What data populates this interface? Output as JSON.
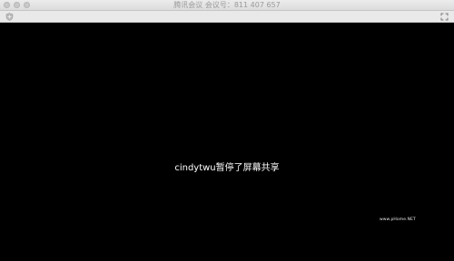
{
  "window": {
    "title": "腾讯会议 会议号：811 407 657"
  },
  "screen": {
    "message": "cindytwu暂停了屏幕共享",
    "watermark": "www.pHome.NET"
  },
  "icons": {
    "left_toolbar": "shield-icon",
    "right_toolbar": "expand-icon"
  }
}
